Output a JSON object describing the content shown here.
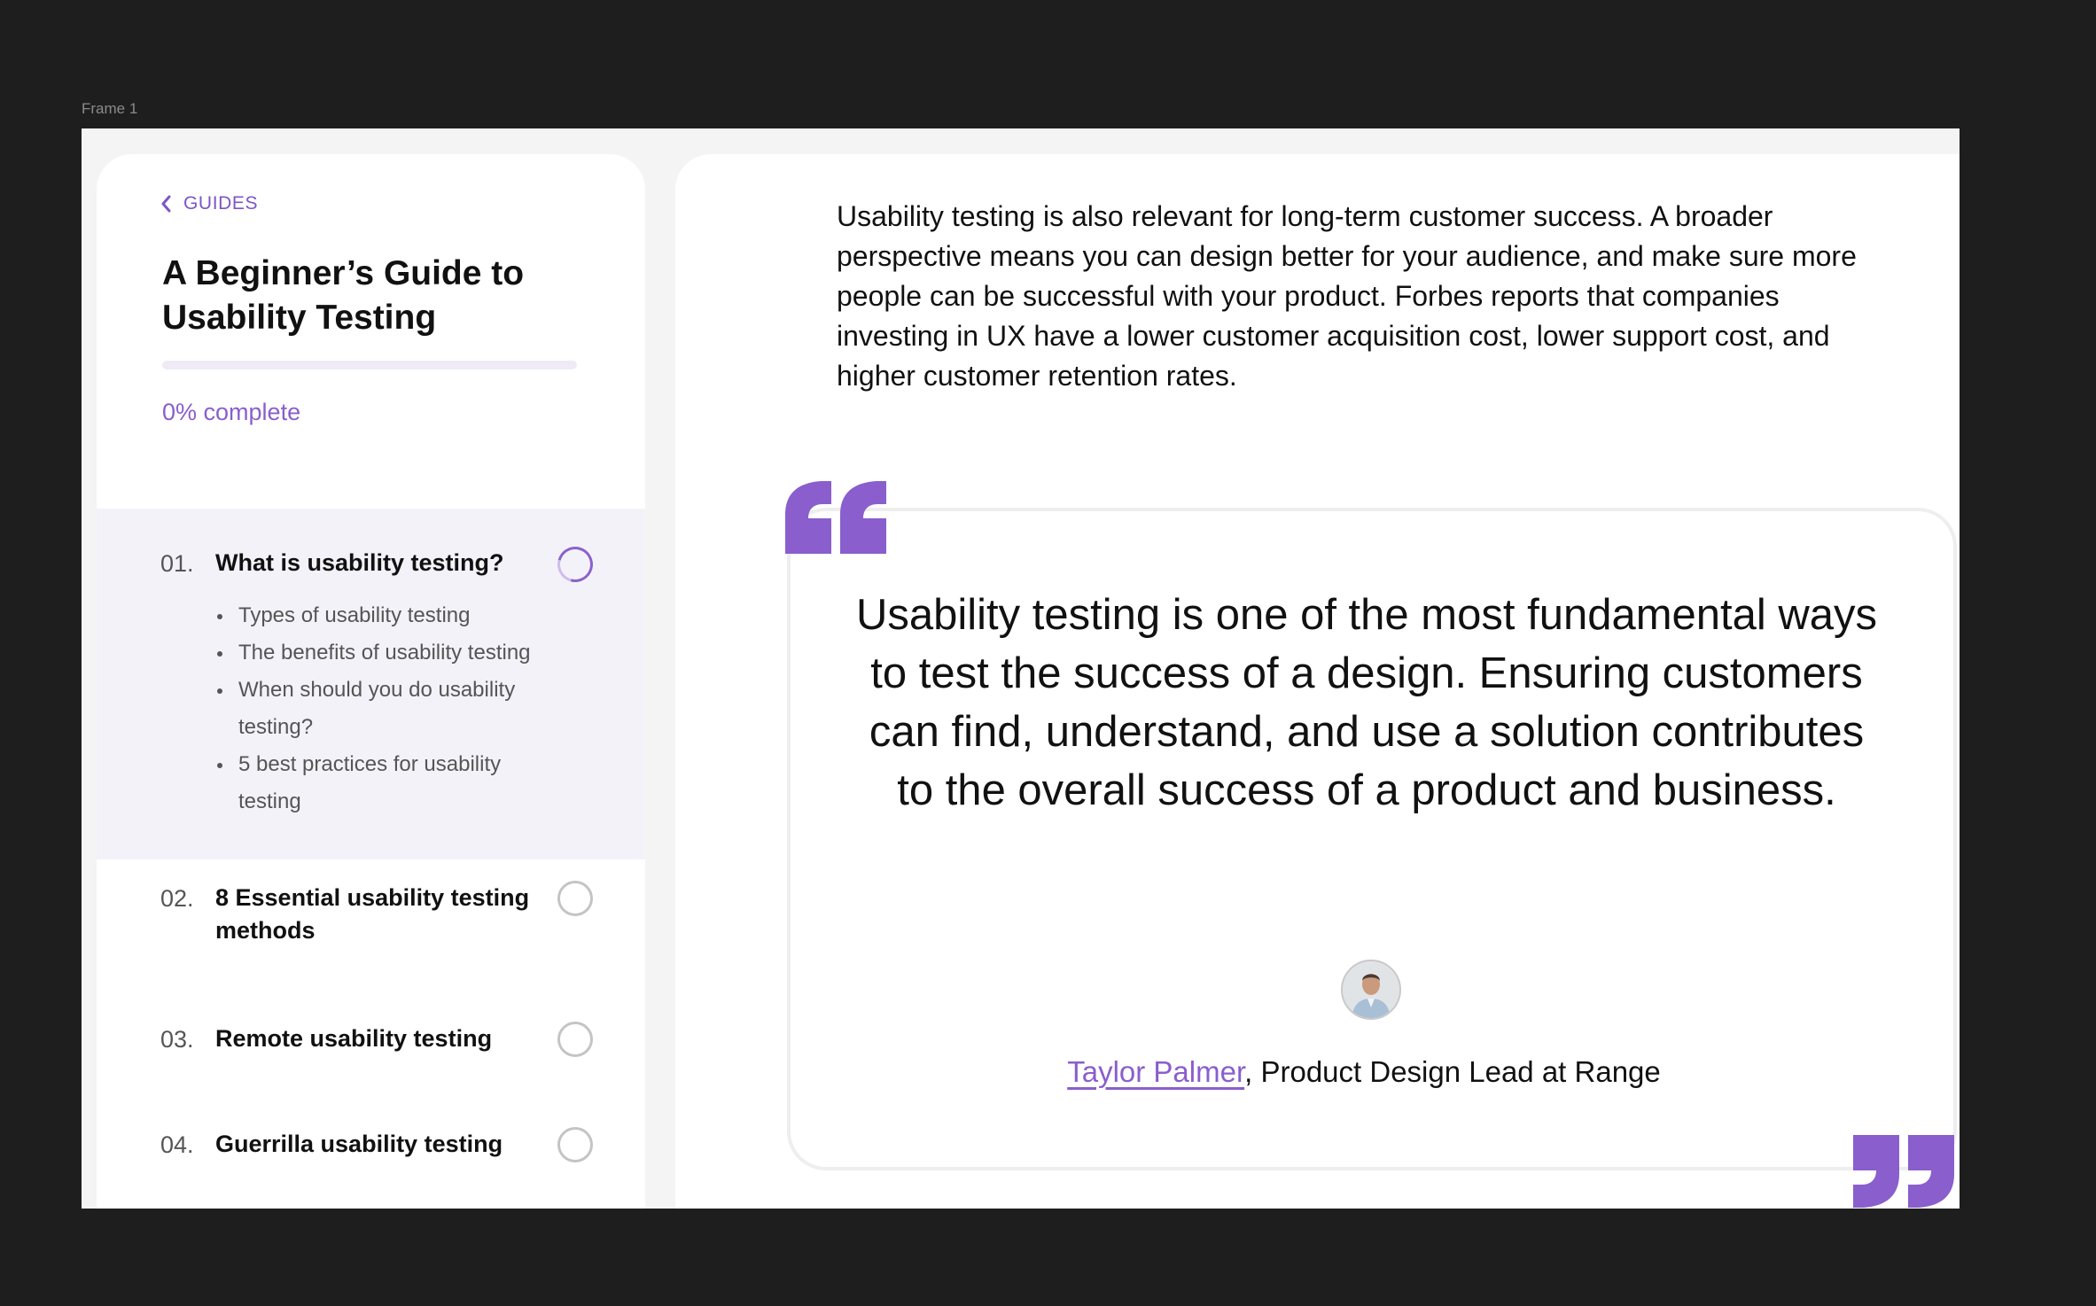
{
  "canvas": {
    "frame_label": "Frame 1"
  },
  "sidebar": {
    "back_label": "GUIDES",
    "title": "A Beginner’s Guide to Usability Testing",
    "progress_fraction": 0,
    "progress_label": "0% complete",
    "sections": [
      {
        "number": "01.",
        "title": "What is usability testing?",
        "active": true,
        "subitems": [
          "Types of usability testing",
          "The benefits of usability testing",
          "When should you do usability testing?",
          "5 best practices for usability testing"
        ]
      },
      {
        "number": "02.",
        "title": "8 Essential usability testing methods",
        "active": false
      },
      {
        "number": "03.",
        "title": "Remote usability testing",
        "active": false
      },
      {
        "number": "04.",
        "title": "Guerrilla usability testing",
        "active": false
      }
    ]
  },
  "main": {
    "paragraph": "Usability testing is also relevant for long-term customer success. A broader perspective means you can design better for your audience, and make sure more people can be successful with your product. Forbes reports that companies investing in UX have a lower customer acquisition cost, lower support cost, and higher customer retention rates.",
    "quote": {
      "text": "Usability testing is one of the most fundamental ways to test the success of a design. Ensuring customers can find, understand, and use a solution contributes to the overall success of a product and business.",
      "author_name": "Taylor Palmer",
      "author_role": ", Product Design Lead at Range",
      "open_icon": "open-quote-icon",
      "close_icon": "close-quote-icon"
    }
  },
  "colors": {
    "accent": "#8a5ecc",
    "quote_mark": "#8a5ecc",
    "active_section_bg": "#f4f2f9",
    "canvas_bg": "#1e1e1e"
  }
}
